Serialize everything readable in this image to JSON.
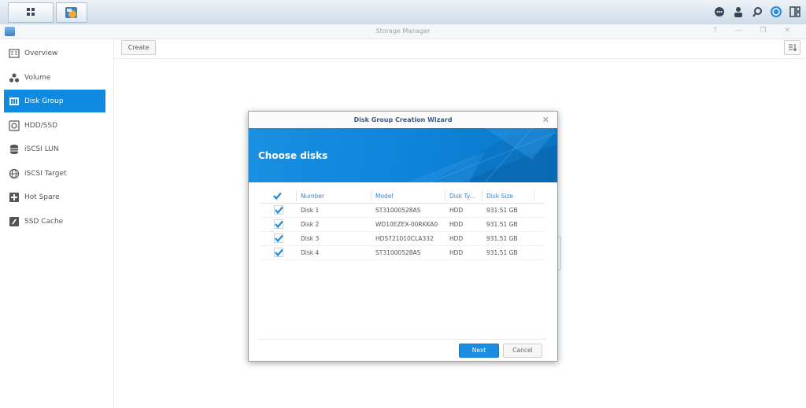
{
  "window": {
    "title": "Storage Manager",
    "controls": "? — ❐ ✕"
  },
  "toolbar": {
    "create_label": "Create"
  },
  "sidebar": {
    "items": [
      {
        "label": "Overview",
        "icon": "overview-icon"
      },
      {
        "label": "Volume",
        "icon": "volume-icon"
      },
      {
        "label": "Disk Group",
        "icon": "disk-group-icon",
        "active": true
      },
      {
        "label": "HDD/SSD",
        "icon": "hdd-icon"
      },
      {
        "label": "iSCSI LUN",
        "icon": "iscsi-lun-icon"
      },
      {
        "label": "iSCSI Target",
        "icon": "iscsi-target-icon"
      },
      {
        "label": "Hot Spare",
        "icon": "hot-spare-icon"
      },
      {
        "label": "SSD Cache",
        "icon": "ssd-cache-icon"
      }
    ]
  },
  "dialog": {
    "title": "Disk Group Creation Wizard",
    "headline": "Choose disks",
    "columns": {
      "number": "Number",
      "model": "Model",
      "disk_type": "Disk Ty...",
      "disk_size": "Disk Size"
    },
    "rows": [
      {
        "number": "Disk 1",
        "model": "ST31000528AS",
        "type": "HDD",
        "size": "931.51 GB",
        "checked": true
      },
      {
        "number": "Disk 2",
        "model": "WD10EZEX-00RKKA0",
        "type": "HDD",
        "size": "931.51 GB",
        "checked": true
      },
      {
        "number": "Disk 3",
        "model": "HDS721010CLA332",
        "type": "HDD",
        "size": "931.51 GB",
        "checked": true
      },
      {
        "number": "Disk 4",
        "model": "ST31000528AS",
        "type": "HDD",
        "size": "931.51 GB",
        "checked": true
      }
    ],
    "next_label": "Next",
    "cancel_label": "Cancel"
  },
  "colors": {
    "accent": "#0e8be0",
    "banner": "#1b8fe0",
    "header_text": "#3f82c9"
  }
}
